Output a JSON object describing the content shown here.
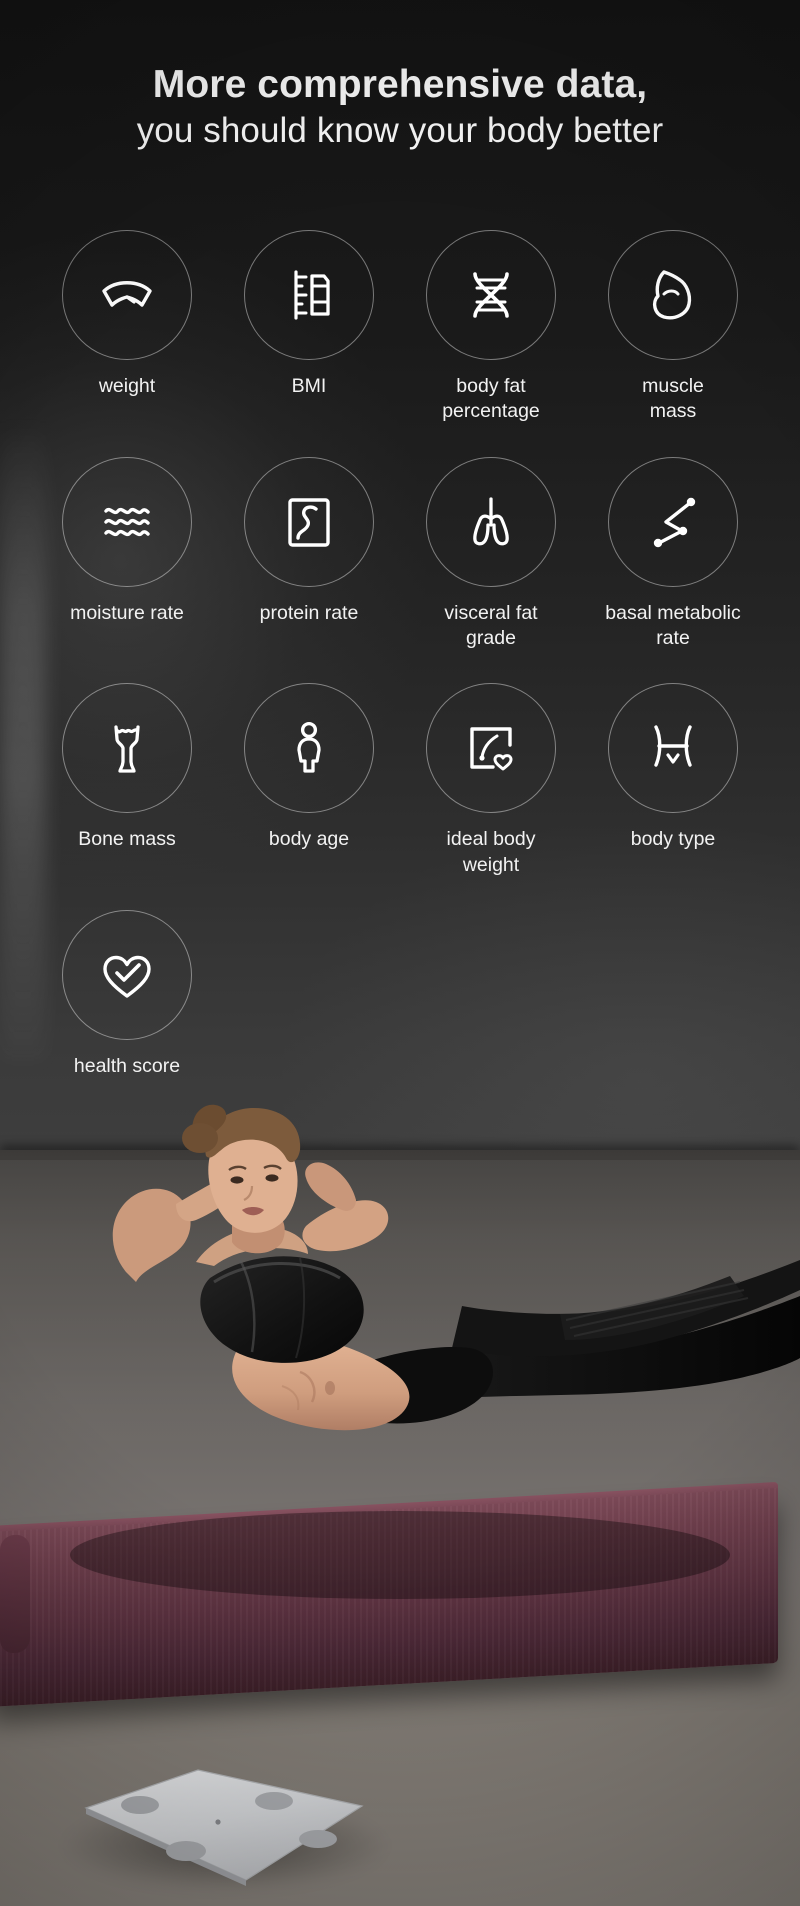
{
  "page": {
    "background_color": "#121212",
    "text_color": "#ffffff",
    "circle_border_color": "rgba(255,255,255,0.42)"
  },
  "headline": {
    "line1": "More comprehensive data,",
    "line2": "you should know your body better"
  },
  "features": [
    {
      "label": "weight",
      "icon": "gauge-icon"
    },
    {
      "label": "BMI",
      "icon": "ruler-icon"
    },
    {
      "label": "body fat\npercentage",
      "icon": "dna-icon"
    },
    {
      "label": "muscle\nmass",
      "icon": "bicep-icon"
    },
    {
      "label": "moisture rate",
      "icon": "waves-icon"
    },
    {
      "label": "protein rate",
      "icon": "protein-icon"
    },
    {
      "label": "visceral fat\ngrade",
      "icon": "lungs-icon"
    },
    {
      "label": "basal metabolic\nrate",
      "icon": "metabolism-icon"
    },
    {
      "label": "Bone mass",
      "icon": "bone-icon"
    },
    {
      "label": "body age",
      "icon": "person-icon"
    },
    {
      "label": "ideal body\nweight",
      "icon": "heart-gauge-icon"
    },
    {
      "label": "body type",
      "icon": "body-type-icon"
    },
    {
      "label": "health score",
      "icon": "heart-check-icon"
    }
  ],
  "photo": {
    "subject_description": "woman doing sit-ups on a yoga mat",
    "mat_color": "#5e3342",
    "floor_color": "#7b7673",
    "product": "smart body fat scale"
  }
}
